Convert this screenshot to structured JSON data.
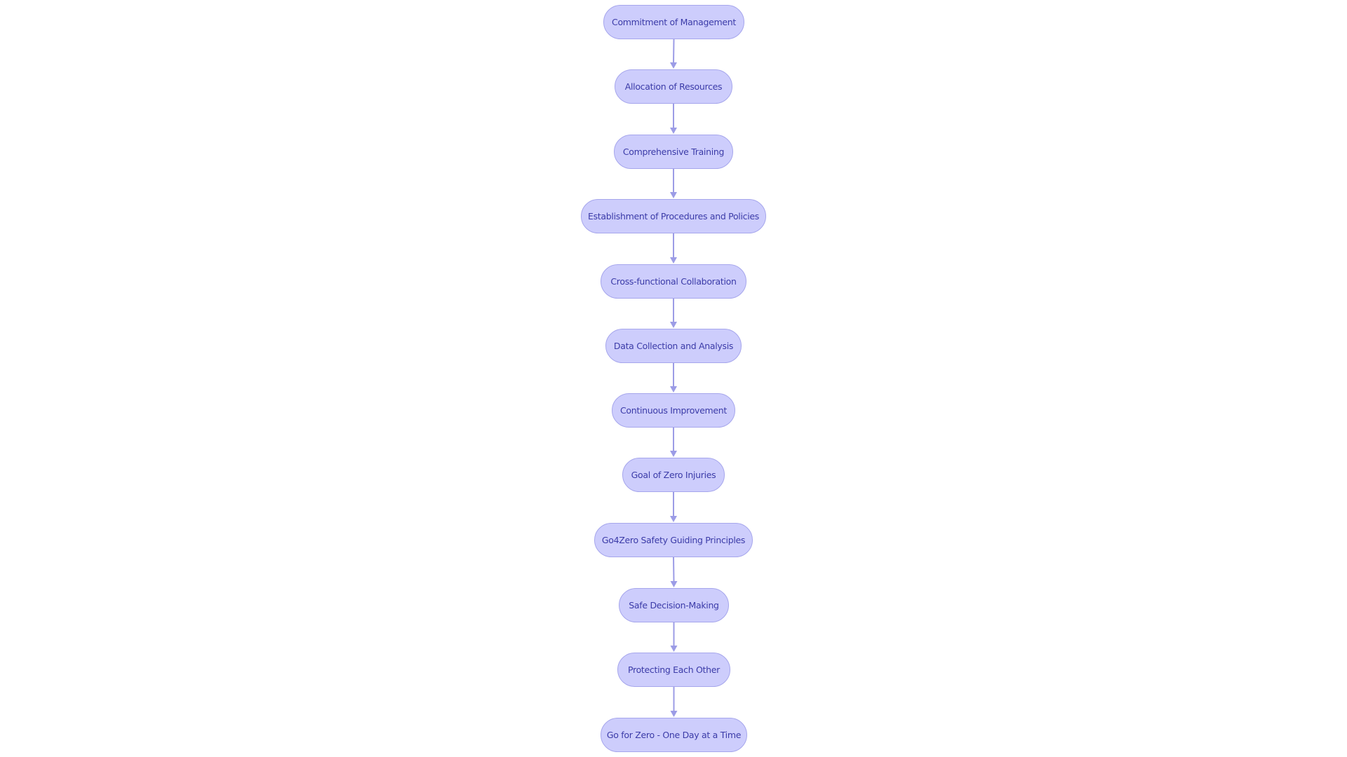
{
  "diagram": {
    "type": "flowchart",
    "direction": "top-to-bottom",
    "colors": {
      "node_fill": "#cdcdfc",
      "node_stroke": "#a6a6ec",
      "node_text": "#3b3ba8",
      "edge": "#9c9ce6"
    },
    "nodes": [
      {
        "id": "n1",
        "label": "Commitment of Management"
      },
      {
        "id": "n2",
        "label": "Allocation of Resources"
      },
      {
        "id": "n3",
        "label": "Comprehensive Training"
      },
      {
        "id": "n4",
        "label": "Establishment of Procedures and Policies"
      },
      {
        "id": "n5",
        "label": "Cross-functional Collaboration"
      },
      {
        "id": "n6",
        "label": "Data Collection and Analysis"
      },
      {
        "id": "n7",
        "label": "Continuous Improvement"
      },
      {
        "id": "n8",
        "label": "Goal of Zero Injuries"
      },
      {
        "id": "n9",
        "label": "Go4Zero Safety Guiding Principles"
      },
      {
        "id": "n10",
        "label": "Safe Decision-Making"
      },
      {
        "id": "n11",
        "label": "Protecting Each Other"
      },
      {
        "id": "n12",
        "label": "Go for Zero - One Day at a Time"
      }
    ],
    "edges": [
      {
        "from": "n1",
        "to": "n2"
      },
      {
        "from": "n2",
        "to": "n3"
      },
      {
        "from": "n3",
        "to": "n4"
      },
      {
        "from": "n4",
        "to": "n5"
      },
      {
        "from": "n5",
        "to": "n6"
      },
      {
        "from": "n6",
        "to": "n7"
      },
      {
        "from": "n7",
        "to": "n8"
      },
      {
        "from": "n8",
        "to": "n9"
      },
      {
        "from": "n9",
        "to": "n10"
      },
      {
        "from": "n10",
        "to": "n11"
      },
      {
        "from": "n11",
        "to": "n12"
      }
    ]
  }
}
